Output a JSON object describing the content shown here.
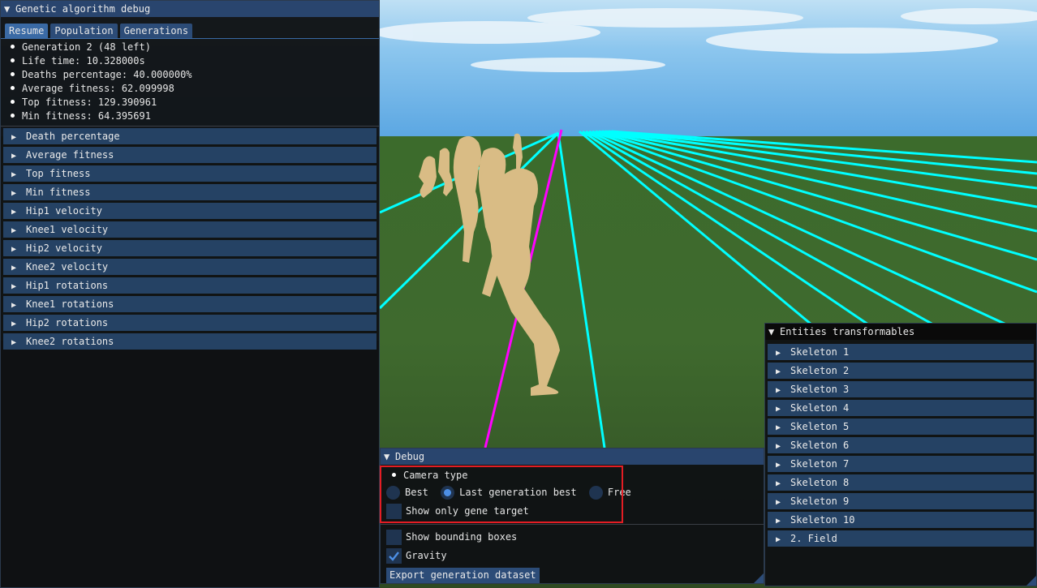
{
  "ga_window": {
    "title": "Genetic algorithm debug",
    "tabs": [
      "Resume",
      "Population",
      "Generations"
    ],
    "stats": [
      "Generation 2 (48 left)",
      "Life time: 10.328000s",
      "Deaths percentage: 40.000000%",
      "Average fitness: 62.099998",
      "Top fitness: 129.390961",
      "Min fitness: 64.395691"
    ],
    "sections": [
      "Death percentage",
      "Average fitness",
      "Top fitness",
      "Min fitness",
      "Hip1 velocity",
      "Knee1 velocity",
      "Hip2 velocity",
      "Knee2 velocity",
      "Hip1 rotations",
      "Knee1 rotations",
      "Hip2 rotations",
      "Knee2 rotations"
    ]
  },
  "entities_window": {
    "title": "Entities transformables",
    "items": [
      "Skeleton 1",
      "Skeleton 2",
      "Skeleton 3",
      "Skeleton 4",
      "Skeleton 5",
      "Skeleton 6",
      "Skeleton 7",
      "Skeleton 8",
      "Skeleton 9",
      "Skeleton 10",
      "2. Field"
    ]
  },
  "debug_window": {
    "title": "Debug",
    "camera_type_label": "Camera type",
    "camera_options": [
      "Best",
      "Last generation best",
      "Free"
    ],
    "camera_selected": "Last generation best",
    "show_gene_target_label": "Show only gene target",
    "show_gene_target": false,
    "show_bounding_boxes_label": "Show bounding boxes",
    "show_bounding_boxes": false,
    "gravity_label": "Gravity",
    "gravity": true,
    "export_button": "Export generation dataset"
  },
  "scene": {
    "sky_color": "#6fb2e6",
    "ground_color": "#3f6a2e",
    "lane_color": "#00ffff",
    "target_line_color": "#ff00ff",
    "figure_color": "#d9bc85",
    "highlight_color": "#e31d24"
  }
}
